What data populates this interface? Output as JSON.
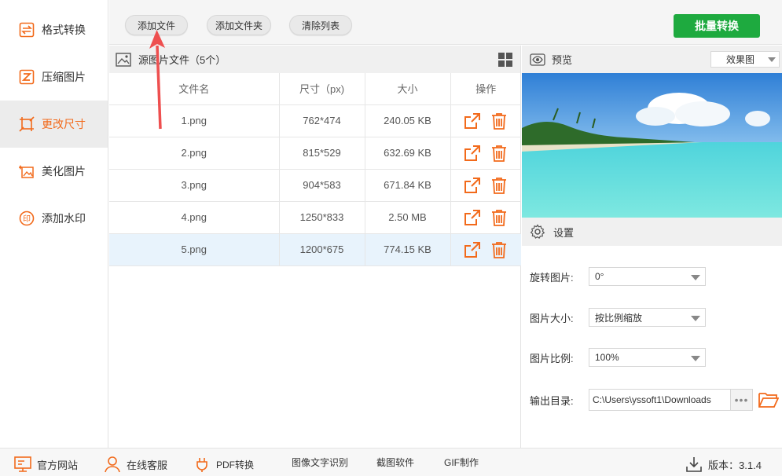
{
  "sidebar": {
    "items": [
      {
        "label": "格式转换",
        "icon": "swap-icon"
      },
      {
        "label": "压缩图片",
        "icon": "compress-icon"
      },
      {
        "label": "更改尺寸",
        "icon": "resize-icon"
      },
      {
        "label": "美化图片",
        "icon": "beautify-icon"
      },
      {
        "label": "添加水印",
        "icon": "watermark-icon"
      }
    ],
    "active_index": 2
  },
  "toolbar": {
    "add_file": "添加文件",
    "add_folder": "添加文件夹",
    "clear_list": "清除列表",
    "batch_convert": "批量转换"
  },
  "file_panel": {
    "title": "源图片文件（5个）",
    "columns": [
      "文件名",
      "尺寸（px)",
      "大小",
      "操作"
    ],
    "rows": [
      {
        "name": "1.png",
        "size": "762*474",
        "filesize": "240.05 KB"
      },
      {
        "name": "2.png",
        "size": "815*529",
        "filesize": "632.69 KB"
      },
      {
        "name": "3.png",
        "size": "904*583",
        "filesize": "671.84 KB"
      },
      {
        "name": "4.png",
        "size": "1250*833",
        "filesize": "2.50 MB"
      },
      {
        "name": "5.png",
        "size": "1200*675",
        "filesize": "774.15 KB"
      }
    ],
    "selected_index": 4
  },
  "preview": {
    "title": "预览",
    "mode": "效果图"
  },
  "settings": {
    "title": "设置",
    "rotate_label": "旋转图片:",
    "rotate_value": "0°",
    "size_label": "图片大小:",
    "size_value": "按比例缩放",
    "ratio_label": "图片比例:",
    "ratio_value": "100%",
    "output_label": "输出目录:",
    "output_value": "C:\\Users\\yssoft1\\Downloads",
    "dots": "•••"
  },
  "bottom": {
    "website": "官方网站",
    "support": "在线客服",
    "pdf": "PDF转换",
    "ocr": "图像文字识别",
    "screenshot": "截图软件",
    "gif": "GIF制作",
    "version_label": "版本：",
    "version": "3.1.4"
  },
  "colors": {
    "accent": "#f26a1b",
    "green": "#1eaa3f",
    "selected_row": "#e8f3fc",
    "arrow": "#ee4f4f"
  }
}
